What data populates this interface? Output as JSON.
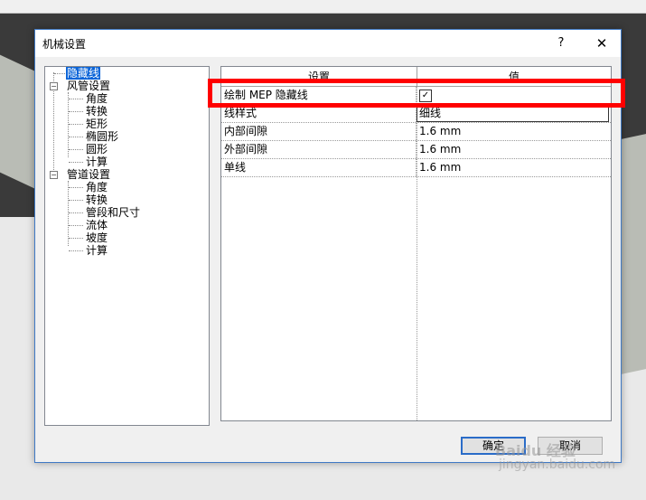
{
  "dialog": {
    "title": "机械设置",
    "help_label": "?",
    "close_label": "✕"
  },
  "tree": {
    "items": [
      {
        "label": "隐藏线",
        "selected": true
      },
      {
        "label": "风管设置"
      },
      {
        "label": "角度"
      },
      {
        "label": "转换"
      },
      {
        "label": "矩形"
      },
      {
        "label": "椭圆形"
      },
      {
        "label": "圆形"
      },
      {
        "label": "计算"
      },
      {
        "label": "管道设置"
      },
      {
        "label": "角度"
      },
      {
        "label": "转换"
      },
      {
        "label": "管段和尺寸"
      },
      {
        "label": "流体"
      },
      {
        "label": "坡度"
      },
      {
        "label": "计算"
      }
    ]
  },
  "grid": {
    "headers": {
      "setting": "设置",
      "value": "值"
    },
    "rows": [
      {
        "setting": "绘制 MEP 隐藏线",
        "value": "",
        "checked": true
      },
      {
        "setting": "线样式",
        "value": "细线"
      },
      {
        "setting": "内部间隙",
        "value": "1.6 mm"
      },
      {
        "setting": "外部间隙",
        "value": "1.6 mm"
      },
      {
        "setting": "单线",
        "value": "1.6 mm"
      }
    ]
  },
  "buttons": {
    "ok": "确定",
    "cancel": "取消"
  },
  "watermark": {
    "brand": "Baidu 经验",
    "url": "jingyan.baidu.com"
  },
  "colors": {
    "selection": "#0a64d8",
    "highlight_box": "#ff0000",
    "primary_border": "#2a6cc8"
  }
}
